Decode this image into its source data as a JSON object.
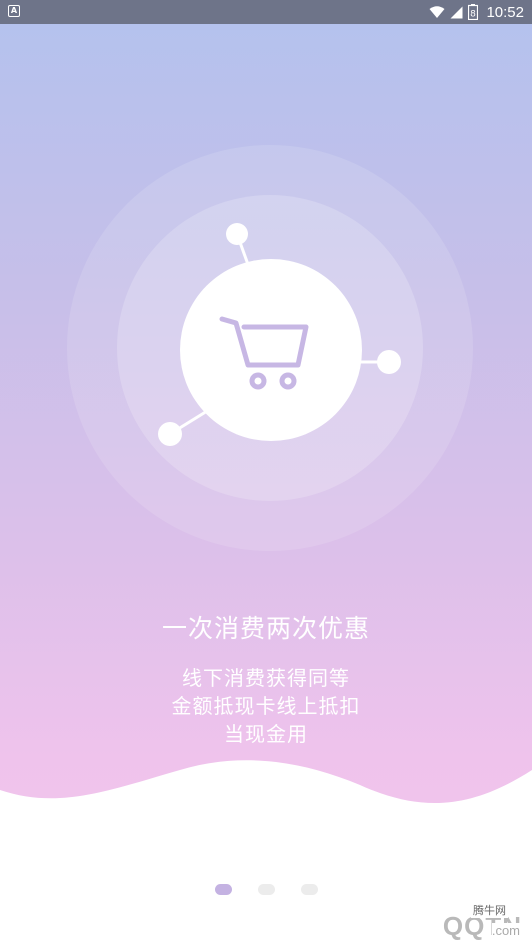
{
  "status_bar": {
    "app_icon": "A",
    "icons": [
      "wifi-icon",
      "signal-icon",
      "battery-icon"
    ],
    "battery_level": "8",
    "time": "10:52"
  },
  "illustration": {
    "center_icon": "shopping-cart-icon",
    "accent_color": "#c7b7e4"
  },
  "onboarding": {
    "title": "一次消费两次优惠",
    "description_lines": [
      "线下消费获得同等",
      "金额抵现卡线上抵扣",
      "当现金用"
    ]
  },
  "pager": {
    "page_count": 3,
    "active_index": 0,
    "active_color": "#c4b2e2",
    "inactive_color": "#ececec"
  },
  "watermark": {
    "tag": "腾牛网",
    "text": "QQTN",
    "suffix": ".com"
  }
}
